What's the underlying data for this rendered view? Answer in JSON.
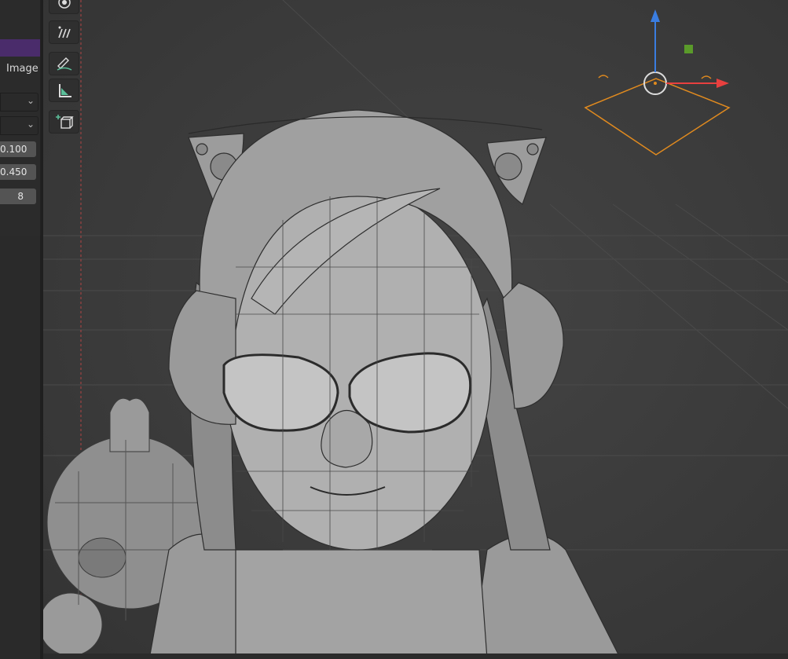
{
  "properties_panel": {
    "label": "Image",
    "field_1": "0.100",
    "field_2": "0.450",
    "field_3": "8"
  },
  "toolbar": {
    "tools": [
      "transform-icon",
      "annotate-icon",
      "annotate-line-icon",
      "measure-icon",
      "add-cube-icon"
    ]
  },
  "colors": {
    "viewport_bg": "#3d3d3d",
    "panel_header": "#4a2c6b",
    "axis_x": "#e8403f",
    "axis_z": "#3a7de0",
    "camera_outline": "#e08a1f",
    "light_marker": "#5a9a2a"
  }
}
